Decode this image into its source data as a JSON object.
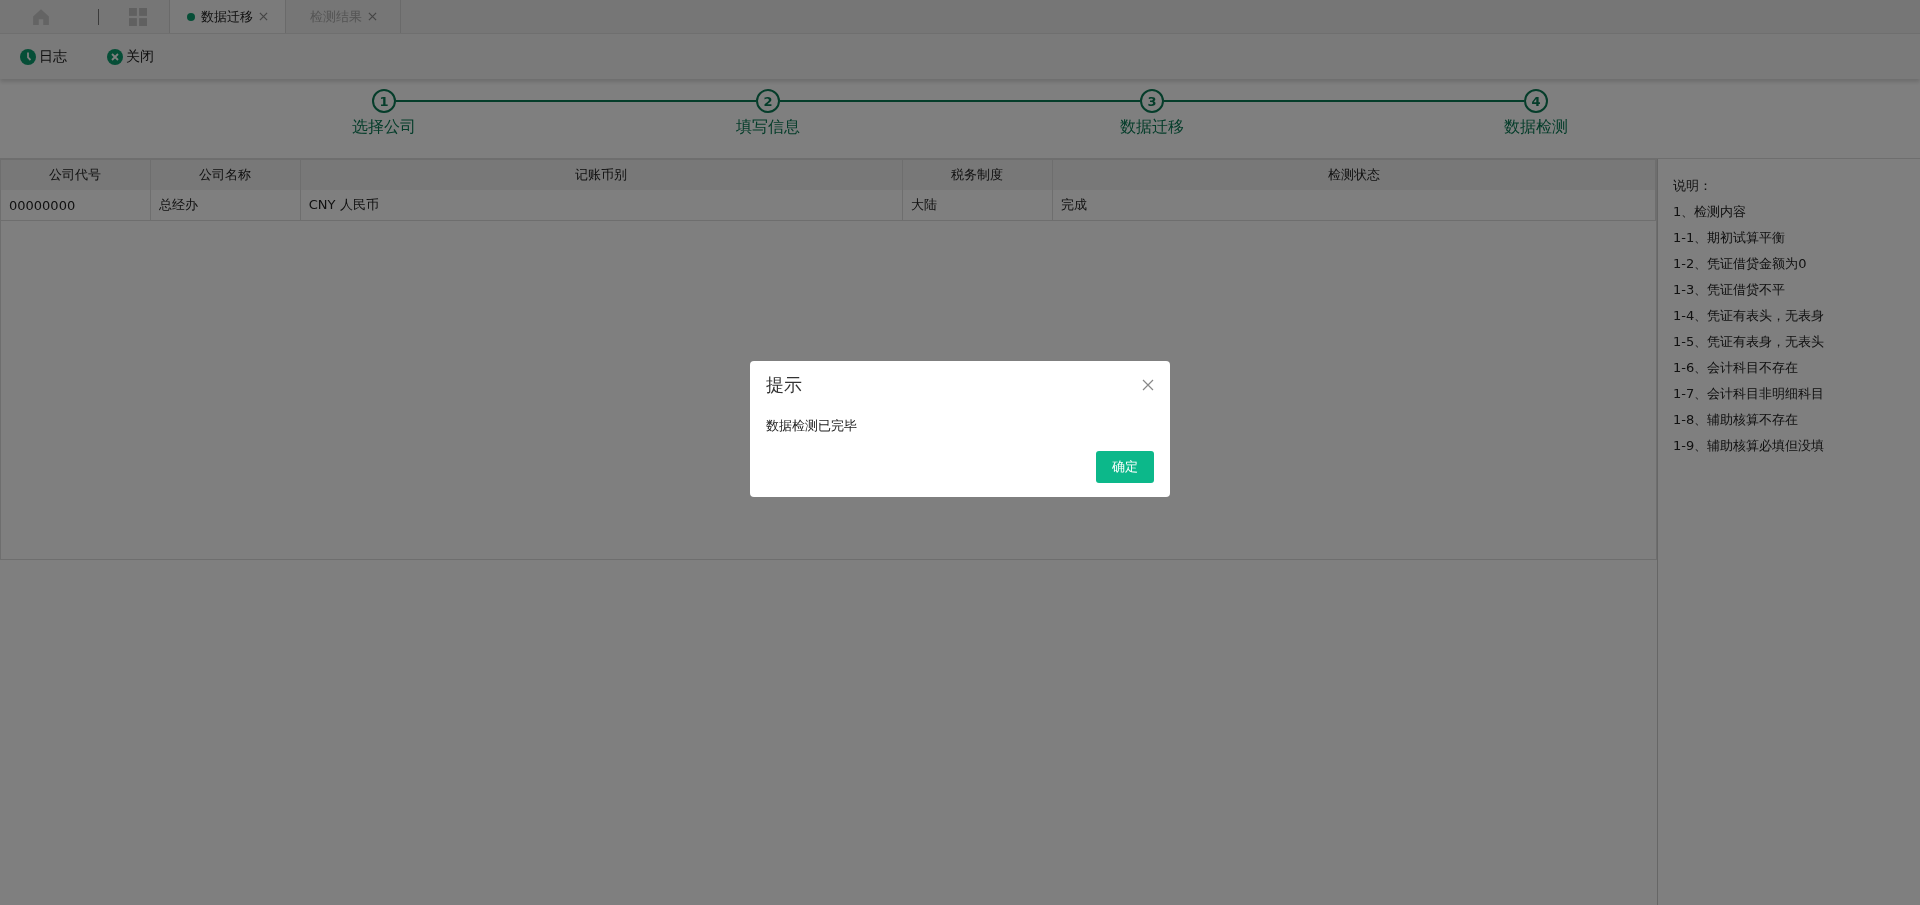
{
  "tabs": [
    {
      "label": "数据迁移",
      "selected": true
    },
    {
      "label": "检测结果",
      "selected": false
    }
  ],
  "toolbar": [
    "日志",
    "关闭"
  ],
  "steps": [
    {
      "number": "1",
      "label": "选择公司"
    },
    {
      "number": "2",
      "label": "填写信息"
    },
    {
      "number": "3",
      "label": "数据迁移"
    },
    {
      "number": "4",
      "label": "数据检测"
    }
  ],
  "table": {
    "columns": [
      "公司代号",
      "公司名称",
      "记账币别",
      "税务制度",
      "检测状态"
    ],
    "rows": [
      [
        "00000000",
        "总经办",
        "CNY 人民币",
        "大陆",
        "完成"
      ]
    ]
  },
  "notes": {
    "title": "说明：",
    "items": [
      "1、检测内容",
      "1-1、期初试算平衡",
      "1-2、凭证借贷金额为0",
      "1-3、凭证借贷不平",
      "1-4、凭证有表头，无表身",
      "1-5、凭证有表身，无表头",
      "1-6、会计科目不存在",
      "1-7、会计科目非明细科目",
      "1-8、辅助核算不存在",
      "1-9、辅助核算必填但没填"
    ]
  },
  "dialog": {
    "title": "提示",
    "message": "数据检测已完毕",
    "confirm": "确定"
  }
}
